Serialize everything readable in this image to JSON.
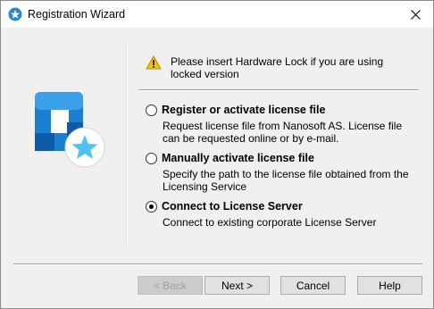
{
  "window": {
    "title": "Registration Wizard"
  },
  "notice": {
    "text": "Please insert Hardware Lock if you are using locked version"
  },
  "options": [
    {
      "label": "Register or activate license file",
      "description": "Request license file from Nanosoft AS. License file can be requested online or by e-mail.",
      "selected": false
    },
    {
      "label": "Manually activate license file",
      "description": "Specify the path to the license file obtained from the Licensing Service",
      "selected": false
    },
    {
      "label": "Connect to License Server",
      "description": "Connect to existing corporate License Server",
      "selected": true
    }
  ],
  "buttons": {
    "back": "< Back",
    "next": "Next >",
    "cancel": "Cancel",
    "help": "Help"
  },
  "colors": {
    "logo_blue": "#1a7fd0",
    "logo_dark": "#0e5aa7",
    "star": "#4fc3f7",
    "warn": "#f5c000"
  }
}
